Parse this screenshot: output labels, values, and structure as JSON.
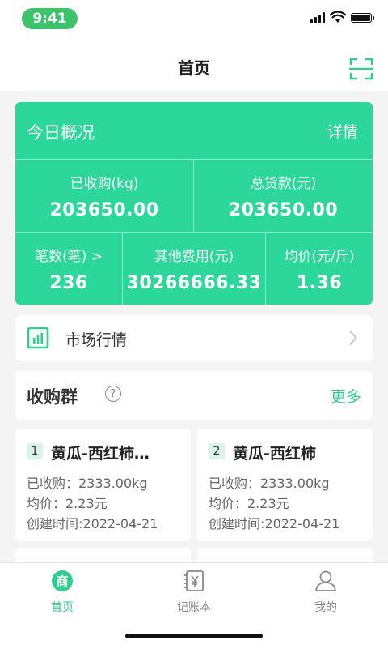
{
  "status": {
    "time": "9:41"
  },
  "nav": {
    "title": "首页",
    "scan_icon": "scan-icon"
  },
  "summary": {
    "title": "今日概况",
    "detail": "详情",
    "purchased_label": "已收购(kg)",
    "purchased_value": "203650.00",
    "total_label": "总货款(元)",
    "total_value": "203650.00",
    "count_label": "笔数(笔) >",
    "count_value": "236",
    "other_label": "其他费用(元)",
    "other_value": "30266666.33",
    "avg_label": "均价(元/斤)",
    "avg_value": "1.36"
  },
  "market": {
    "label": "市场行情",
    "icon": "chart-icon"
  },
  "group": {
    "title": "收购群",
    "help": "?",
    "more": "更多"
  },
  "group_cards": [
    {
      "num": "1",
      "name": "黄瓜-西红柿…",
      "purchased": "已收购：2333.00kg",
      "avg": "均价：2.23元",
      "created": "创建时间:2022-04-21"
    },
    {
      "num": "2",
      "name": "黄瓜-西红柿",
      "purchased": "已收购：2333.00kg",
      "avg": "均价：2.23元",
      "created": "创建时间:2022-04-21"
    }
  ],
  "tabs": [
    {
      "label": "首页",
      "icon": "shop-icon",
      "active": true
    },
    {
      "label": "记账本",
      "icon": "ledger-icon",
      "active": false
    },
    {
      "label": "我的",
      "icon": "user-icon",
      "active": false
    }
  ],
  "colors": {
    "accent": "#2cd79b",
    "accent_text": "#2ccf8c",
    "status_pill": "#3cc46b"
  }
}
